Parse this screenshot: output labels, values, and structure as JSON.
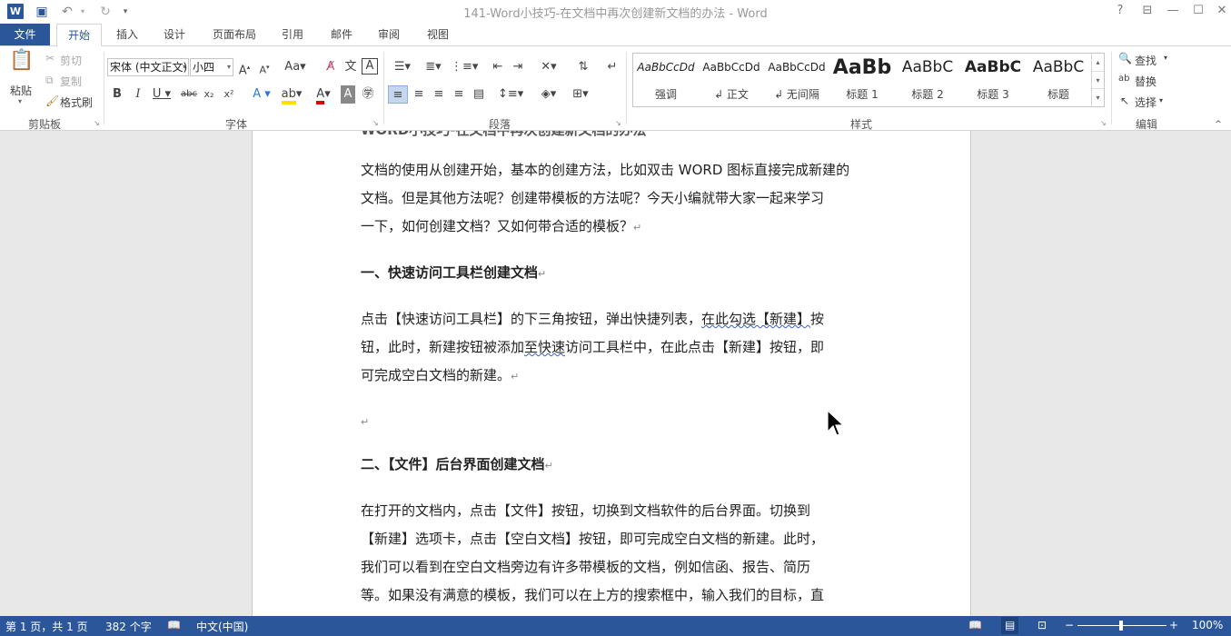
{
  "window": {
    "title": "141-Word小技巧-在文档中再次创建新文档的办法 - Word",
    "help": "?",
    "restore_ribbon": "⊟",
    "minimize": "—",
    "maximize": "☐",
    "close": "✕",
    "app_logo": "W"
  },
  "qat": {
    "save_icon": "💾",
    "undo_icon": "↶",
    "redo_icon": "↻",
    "customize_icon": "▾"
  },
  "tabs": [
    {
      "label": "文件"
    },
    {
      "label": "开始"
    },
    {
      "label": "插入"
    },
    {
      "label": "设计"
    },
    {
      "label": "页面布局"
    },
    {
      "label": "引用"
    },
    {
      "label": "邮件"
    },
    {
      "label": "审阅"
    },
    {
      "label": "视图"
    }
  ],
  "ribbon": {
    "clipboard": {
      "label": "剪贴板",
      "paste": "粘贴",
      "cut": "剪切",
      "copy": "复制",
      "format_painter": "格式刷"
    },
    "font": {
      "label": "字体",
      "font_name": "宋体 (中文正文)",
      "font_size": "小四"
    },
    "paragraph": {
      "label": "段落"
    },
    "styles": {
      "label": "样式",
      "items": [
        {
          "preview": "AaBbCcDd",
          "name": "强调"
        },
        {
          "preview": "AaBbCcDd",
          "name": "↲ 正文"
        },
        {
          "preview": "AaBbCcDd",
          "name": "↲ 无间隔"
        },
        {
          "preview": "AaBb",
          "name": "标题 1"
        },
        {
          "preview": "AaBbC",
          "name": "标题 2"
        },
        {
          "preview": "AaBbC",
          "name": "标题 3"
        },
        {
          "preview": "AaBbC",
          "name": "标题"
        }
      ]
    },
    "editing": {
      "label": "编辑",
      "find": "查找",
      "replace": "替换",
      "select": "选择"
    }
  },
  "document": {
    "top_cut_line": "WORD小技巧-在文档中再次创建新文档的办法",
    "paragraphs": [
      {
        "lines": [
          "文档的使用从创建开始，基本的创建方法，比如双击 WORD 图标直接完成新建的",
          "文档。但是其他方法呢？创建带模板的方法呢？今天小编就带大家一起来学习",
          "一下，如何创建文档？又如何带合适的模板？"
        ]
      },
      {
        "heading": "一、快速访问工具栏创建文档"
      },
      {
        "lines": [
          "点击【快速访问工具栏】的下三角按钮，弹出快捷列表，",
          "钮，此时，新建按钮被添加",
          "访问工具栏中，在此点击【新建】按钮，即",
          "可完成空白文档的新建。"
        ],
        "squiggle_1": "在此勾选【新建】",
        "after_squiggle_1": "按",
        "squiggle_2": "至快速"
      },
      {
        "empty": "↵"
      },
      {
        "heading": "二、【文件】后台界面创建文档"
      },
      {
        "lines": [
          "在打开的文档内，点击【文件】按钮，切换到文档软件的后台界面。切换到",
          "【新建】选项卡，点击【空白文档】按钮，即可完成空白文档的新建。此时，",
          "我们可以看到在空白文档旁边有许多带模板的文档，例如信函、报告、简历",
          "等。如果没有满意的模板，我们可以在上方的搜索框中，输入我们的目标，直"
        ]
      }
    ],
    "para_mark": "↵"
  },
  "status": {
    "page": "第 1 页，共 1 页",
    "words": "382 个字",
    "language": "中文(中国)",
    "zoom": "100%",
    "zoom_fraction": 0.5
  },
  "colors": {
    "accent": "#2b579a"
  }
}
